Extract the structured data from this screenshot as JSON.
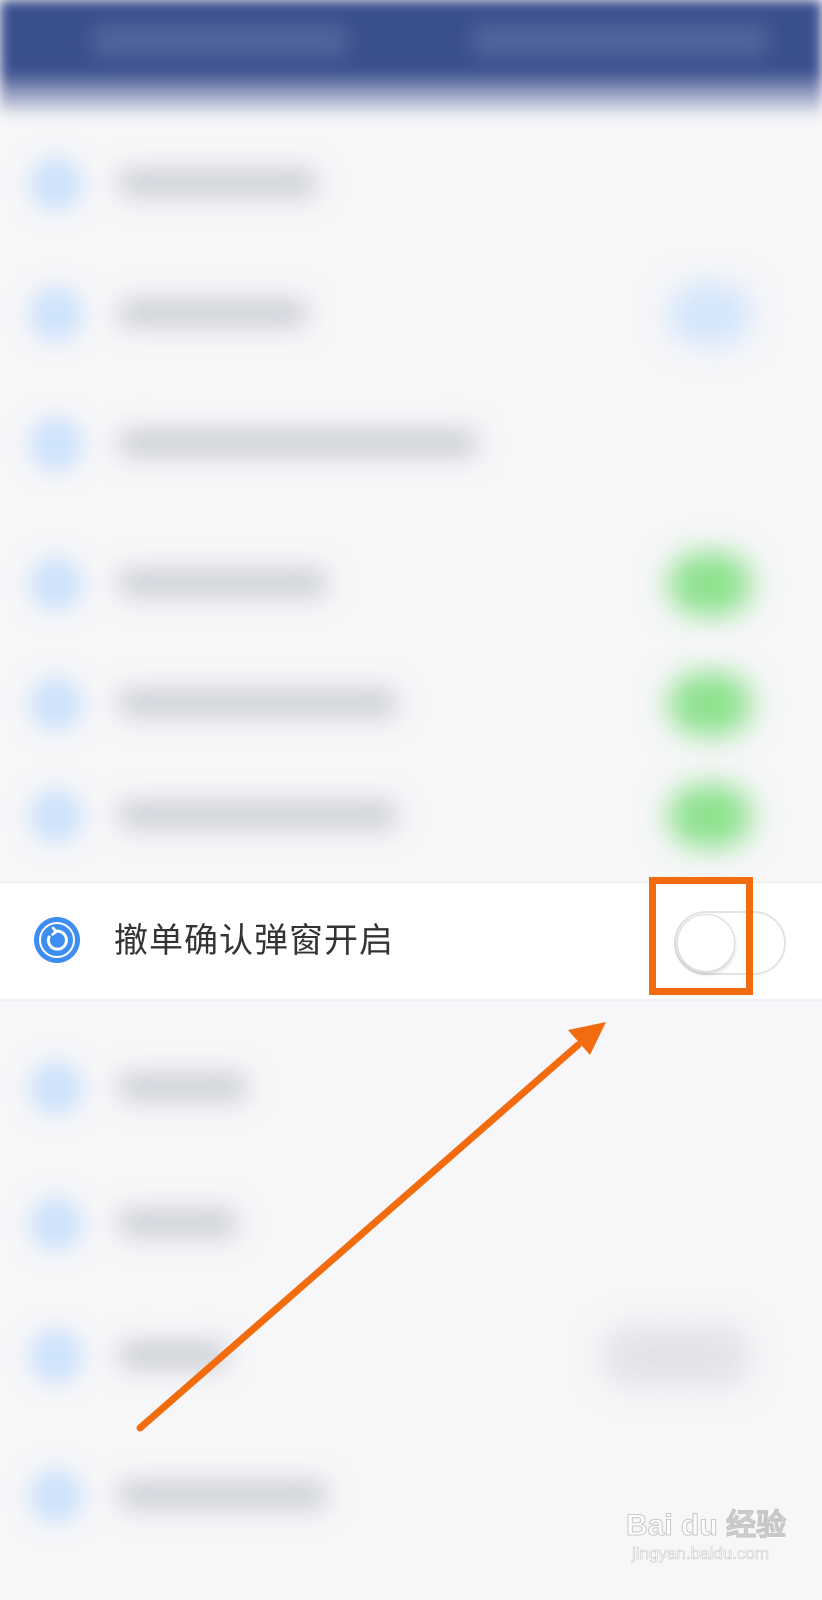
{
  "setting": {
    "label": "撤单确认弹窗开启",
    "icon": "refresh-icon",
    "toggle_on": false
  },
  "colors": {
    "header": "#3a4f8e",
    "accent_icon": "#3d8ef0",
    "annotation": "#f26b0f",
    "blurred_toggle_on": "#8ee28e"
  },
  "watermark": {
    "logo": "Bai du 经验",
    "url": "jingyan.baidu.com"
  }
}
